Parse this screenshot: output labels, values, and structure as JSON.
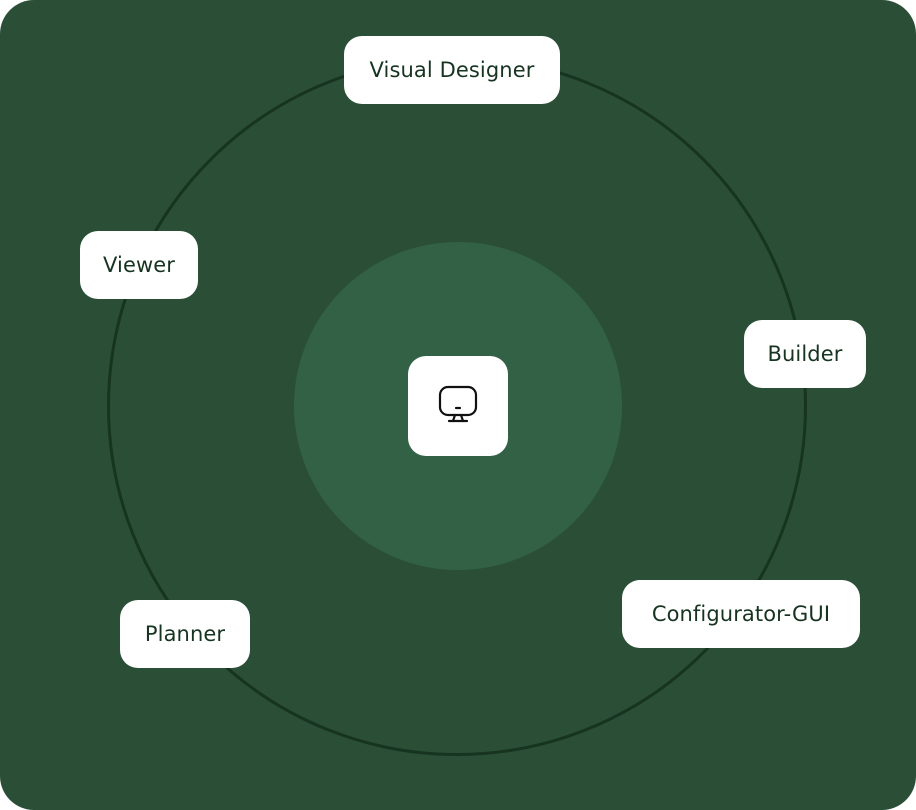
{
  "diagram": {
    "center": {
      "icon": "desktop-monitor-icon"
    },
    "nodes": [
      {
        "id": "visual-designer",
        "label": "Visual Designer"
      },
      {
        "id": "viewer",
        "label": "Viewer"
      },
      {
        "id": "builder",
        "label": "Builder"
      },
      {
        "id": "planner",
        "label": "Planner"
      },
      {
        "id": "configurator-gui",
        "label": "Configurator-GUI"
      }
    ]
  },
  "colors": {
    "background": "#2a4f36",
    "orbit": "#173421",
    "center_disc": "#336145",
    "card": "#ffffff",
    "text": "#173421"
  }
}
